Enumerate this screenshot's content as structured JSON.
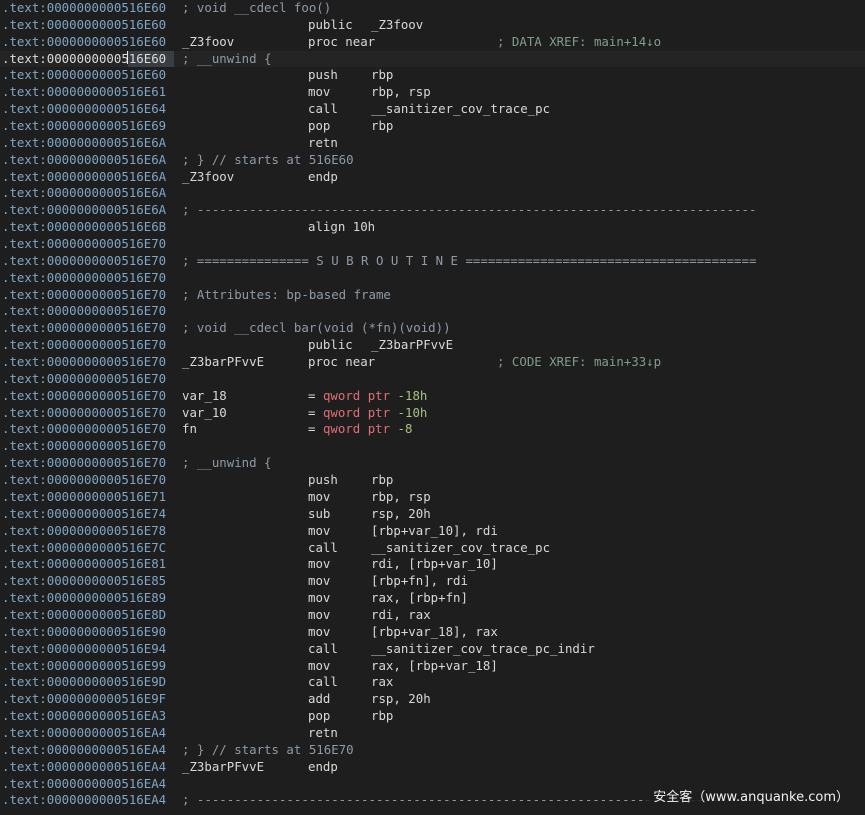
{
  "colors": {
    "background": "#1e1e1e",
    "address": "#7fa6c6",
    "text": "#d8d8d8",
    "comment": "#8f9aa6",
    "xref": "#7f9e8a",
    "pointer": "#e06c75",
    "number": "#a7c080"
  },
  "lines": [
    {
      "addr": ".text:0000000000516E60",
      "comment": "; void __cdecl foo()"
    },
    {
      "addr": ".text:0000000000516E60",
      "mnem": "public",
      "ops": "_Z3foov"
    },
    {
      "addr": ".text:0000000000516E60",
      "label": "_Z3foov",
      "mnem": "proc near",
      "xref": "; DATA XREF: main+14↓o"
    },
    {
      "addr": ".text:0000000000516E60",
      "comment": "; __unwind {",
      "selected": true
    },
    {
      "addr": ".text:0000000000516E60",
      "mnem": "push",
      "ops": "rbp"
    },
    {
      "addr": ".text:0000000000516E61",
      "mnem": "mov",
      "ops": "rbp, rsp"
    },
    {
      "addr": ".text:0000000000516E64",
      "mnem": "call",
      "ops": "__sanitizer_cov_trace_pc"
    },
    {
      "addr": ".text:0000000000516E69",
      "mnem": "pop",
      "ops": "rbp"
    },
    {
      "addr": ".text:0000000000516E6A",
      "mnem": "retn"
    },
    {
      "addr": ".text:0000000000516E6A",
      "comment": "; } // starts at 516E60"
    },
    {
      "addr": ".text:0000000000516E6A",
      "label": "_Z3foov",
      "mnem": "endp"
    },
    {
      "addr": ".text:0000000000516E6A"
    },
    {
      "addr": ".text:0000000000516E6A",
      "comment": "; ---------------------------------------------------------------------------"
    },
    {
      "addr": ".text:0000000000516E6B",
      "mnem": "align 10h"
    },
    {
      "addr": ".text:0000000000516E70"
    },
    {
      "addr": ".text:0000000000516E70",
      "comment": "; =============== S U B R O U T I N E ======================================="
    },
    {
      "addr": ".text:0000000000516E70"
    },
    {
      "addr": ".text:0000000000516E70",
      "comment": "; Attributes: bp-based frame"
    },
    {
      "addr": ".text:0000000000516E70"
    },
    {
      "addr": ".text:0000000000516E70",
      "comment": "; void __cdecl bar(void (*fn)(void))"
    },
    {
      "addr": ".text:0000000000516E70",
      "mnem": "public",
      "ops": "_Z3barPFvvE"
    },
    {
      "addr": ".text:0000000000516E70",
      "label": "_Z3barPFvvE",
      "mnem": "proc near",
      "xref": "; CODE XREF: main+33↓p"
    },
    {
      "addr": ".text:0000000000516E70"
    },
    {
      "addr": ".text:0000000000516E70",
      "label": "var_18",
      "vareq": "=",
      "ptr": "qword ptr",
      "num": "-18h"
    },
    {
      "addr": ".text:0000000000516E70",
      "label": "var_10",
      "vareq": "=",
      "ptr": "qword ptr",
      "num": "-10h"
    },
    {
      "addr": ".text:0000000000516E70",
      "label": "fn",
      "vareq": "=",
      "ptr": "qword ptr",
      "num": "-8"
    },
    {
      "addr": ".text:0000000000516E70"
    },
    {
      "addr": ".text:0000000000516E70",
      "comment": "; __unwind {"
    },
    {
      "addr": ".text:0000000000516E70",
      "mnem": "push",
      "ops": "rbp"
    },
    {
      "addr": ".text:0000000000516E71",
      "mnem": "mov",
      "ops": "rbp, rsp"
    },
    {
      "addr": ".text:0000000000516E74",
      "mnem": "sub",
      "ops": "rsp, 20h"
    },
    {
      "addr": ".text:0000000000516E78",
      "mnem": "mov",
      "ops": "[rbp+var_10], rdi"
    },
    {
      "addr": ".text:0000000000516E7C",
      "mnem": "call",
      "ops": "__sanitizer_cov_trace_pc"
    },
    {
      "addr": ".text:0000000000516E81",
      "mnem": "mov",
      "ops": "rdi, [rbp+var_10]"
    },
    {
      "addr": ".text:0000000000516E85",
      "mnem": "mov",
      "ops": "[rbp+fn], rdi"
    },
    {
      "addr": ".text:0000000000516E89",
      "mnem": "mov",
      "ops": "rax, [rbp+fn]"
    },
    {
      "addr": ".text:0000000000516E8D",
      "mnem": "mov",
      "ops": "rdi, rax"
    },
    {
      "addr": ".text:0000000000516E90",
      "mnem": "mov",
      "ops": "[rbp+var_18], rax"
    },
    {
      "addr": ".text:0000000000516E94",
      "mnem": "call",
      "ops": "__sanitizer_cov_trace_pc_indir"
    },
    {
      "addr": ".text:0000000000516E99",
      "mnem": "mov",
      "ops": "rax, [rbp+var_18]"
    },
    {
      "addr": ".text:0000000000516E9D",
      "mnem": "call",
      "ops": "rax"
    },
    {
      "addr": ".text:0000000000516E9F",
      "mnem": "add",
      "ops": "rsp, 20h"
    },
    {
      "addr": ".text:0000000000516EA3",
      "mnem": "pop",
      "ops": "rbp"
    },
    {
      "addr": ".text:0000000000516EA4",
      "mnem": "retn"
    },
    {
      "addr": ".text:0000000000516EA4",
      "comment": "; } // starts at 516E70"
    },
    {
      "addr": ".text:0000000000516EA4",
      "label": "_Z3barPFvvE",
      "mnem": "endp"
    },
    {
      "addr": ".text:0000000000516EA4"
    },
    {
      "addr": ".text:0000000000516EA4",
      "comment": "; ---------------------------------------------------------------------------"
    }
  ],
  "watermark": "安全客（www.anquanke.com）"
}
